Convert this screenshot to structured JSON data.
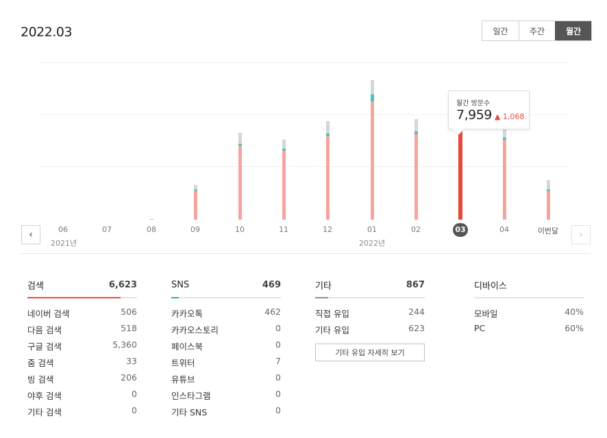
{
  "title": "2022.03",
  "period_tabs": [
    {
      "label": "일간",
      "active": false
    },
    {
      "label": "주간",
      "active": false
    },
    {
      "label": "월간",
      "active": true
    }
  ],
  "chart_data": {
    "type": "bar",
    "categories": [
      "06",
      "07",
      "08",
      "09",
      "10",
      "11",
      "12",
      "01",
      "02",
      "03",
      "04",
      "이번달"
    ],
    "selected": "03",
    "series": [
      {
        "values": [
          0,
          0,
          5,
          1240,
          3200,
          3000,
          3600,
          5100,
          3700,
          4040,
          3450,
          1250
        ]
      },
      {
        "values": [
          0,
          0,
          0,
          50,
          100,
          90,
          110,
          300,
          120,
          240,
          90,
          50
        ]
      },
      {
        "values": [
          0,
          0,
          0,
          200,
          460,
          380,
          520,
          620,
          540,
          500,
          620,
          400
        ]
      }
    ],
    "ylim": [
      0,
      6800
    ],
    "colors": {
      "main": "#f5a49e",
      "main_selected": "#e8473a",
      "accent": "#4cc4bd",
      "accent_selected": "#15a99f",
      "top": "#d4d6d9",
      "top_selected": "#969aa0"
    }
  },
  "years": [
    "2021년",
    "2022년"
  ],
  "tooltip": {
    "label": "월간 방문수",
    "value": "7,959",
    "change": "▲ 1,068"
  },
  "stats": [
    {
      "title": "검색",
      "total": "6,623",
      "fill_fraction": 0.85,
      "color": "#e8473a",
      "rows": [
        {
          "label": "네이버 검색",
          "value": "506"
        },
        {
          "label": "다음 검색",
          "value": "518"
        },
        {
          "label": "구글 검색",
          "value": "5,360"
        },
        {
          "label": "줌 검색",
          "value": "33"
        },
        {
          "label": "빙 검색",
          "value": "206"
        },
        {
          "label": "야후 검색",
          "value": "0"
        },
        {
          "label": "기타 검색",
          "value": "0"
        }
      ]
    },
    {
      "title": "SNS",
      "total": "469",
      "fill_fraction": 0.07,
      "color": "#15b5a8",
      "rows": [
        {
          "label": "카카오톡",
          "value": "462"
        },
        {
          "label": "카카오스토리",
          "value": "0"
        },
        {
          "label": "페이스북",
          "value": "0"
        },
        {
          "label": "트위터",
          "value": "7"
        },
        {
          "label": "유튜브",
          "value": "0"
        },
        {
          "label": "인스타그램",
          "value": "0"
        },
        {
          "label": "기타 SNS",
          "value": "0"
        }
      ]
    },
    {
      "title": "기타",
      "total": "867",
      "fill_fraction": 0.12,
      "color": "#8a8f96",
      "rows": [
        {
          "label": "직접 유입",
          "value": "244"
        },
        {
          "label": "기타 유입",
          "value": "623"
        }
      ],
      "button": "기타 유입 자세히 보기"
    },
    {
      "title": "디바이스",
      "total": "",
      "fill_fraction": 0,
      "color": "#8a8f96",
      "rows": [
        {
          "label": "모바일",
          "value": "40%"
        },
        {
          "label": "PC",
          "value": "60%"
        }
      ]
    }
  ]
}
